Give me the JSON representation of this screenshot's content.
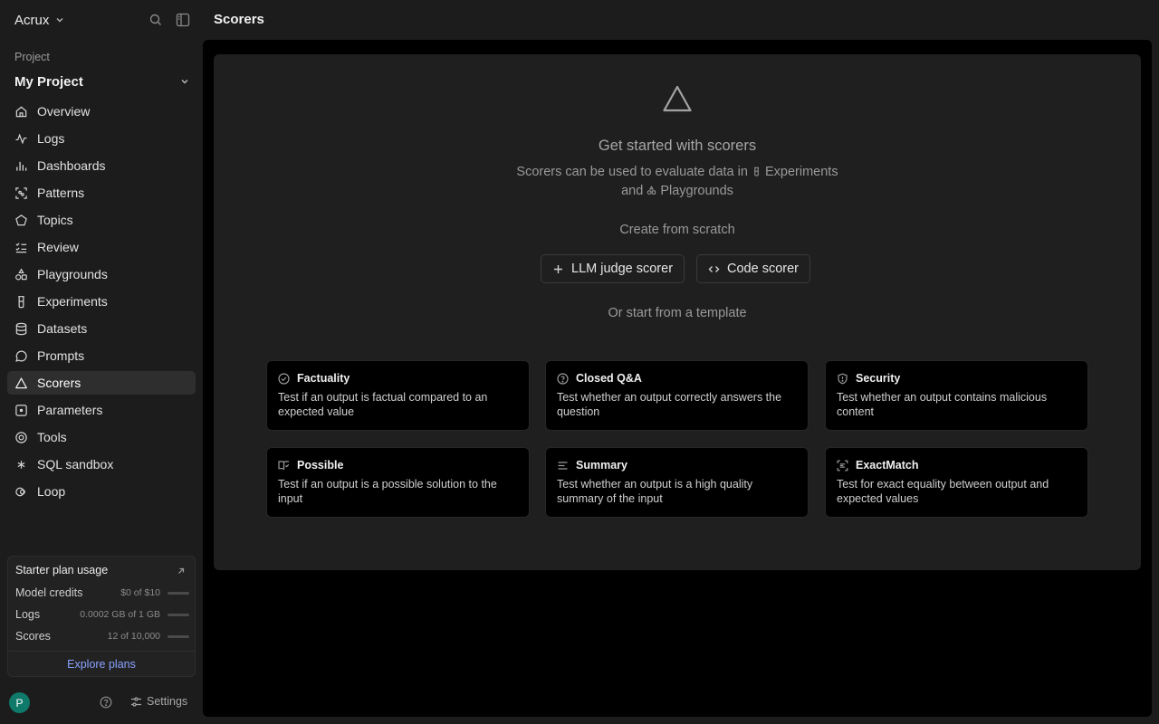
{
  "sidebar": {
    "org_name": "Acrux",
    "project_label": "Project",
    "project_name": "My Project",
    "nav": [
      {
        "label": "Overview",
        "icon": "home-icon"
      },
      {
        "label": "Logs",
        "icon": "activity-icon"
      },
      {
        "label": "Dashboards",
        "icon": "bar-chart-icon"
      },
      {
        "label": "Patterns",
        "icon": "scan-icon"
      },
      {
        "label": "Topics",
        "icon": "pentagon-icon"
      },
      {
        "label": "Review",
        "icon": "checklist-icon"
      },
      {
        "label": "Playgrounds",
        "icon": "shapes-icon"
      },
      {
        "label": "Experiments",
        "icon": "beaker-icon"
      },
      {
        "label": "Datasets",
        "icon": "database-icon"
      },
      {
        "label": "Prompts",
        "icon": "message-icon"
      },
      {
        "label": "Scorers",
        "icon": "triangle-icon",
        "active": true
      },
      {
        "label": "Parameters",
        "icon": "square-dot-icon"
      },
      {
        "label": "Tools",
        "icon": "target-icon"
      },
      {
        "label": "SQL sandbox",
        "icon": "asterisk-icon"
      },
      {
        "label": "Loop",
        "icon": "loop-icon"
      }
    ],
    "usage": {
      "title": "Starter plan usage",
      "rows": [
        {
          "label": "Model credits",
          "value": "$0 of $10",
          "fraction": 0.0
        },
        {
          "label": "Logs",
          "value": "0.0002 GB of 1 GB",
          "fraction": 0.0002
        },
        {
          "label": "Scores",
          "value": "12 of 10,000",
          "fraction": 0.0012
        }
      ],
      "link": "Explore plans"
    },
    "avatar_initial": "P",
    "settings_label": "Settings"
  },
  "header": {
    "title": "Scorers"
  },
  "empty_state": {
    "title": "Get started with scorers",
    "desc_before": "Scorers can be used to evaluate data in",
    "desc_experiments": "Experiments",
    "desc_and": "and",
    "desc_playgrounds": "Playgrounds",
    "create_label": "Create from scratch",
    "llm_button": "LLM judge scorer",
    "code_button": "Code scorer",
    "template_label": "Or start from a template"
  },
  "templates": [
    {
      "name": "Factuality",
      "desc": "Test if an output is factual compared to an expected value",
      "icon": "check-circle-icon"
    },
    {
      "name": "Closed Q&A",
      "desc": "Test whether an output correctly answers the question",
      "icon": "question-circle-icon"
    },
    {
      "name": "Security",
      "desc": "Test whether an output contains malicious content",
      "icon": "shield-icon"
    },
    {
      "name": "Possible",
      "desc": "Test if an output is a possible solution to the input",
      "icon": "book-check-icon"
    },
    {
      "name": "Summary",
      "desc": "Test whether an output is a high quality summary of the input",
      "icon": "text-lines-icon"
    },
    {
      "name": "ExactMatch",
      "desc": "Test for exact equality between output and expected values",
      "icon": "scan-text-icon"
    }
  ]
}
